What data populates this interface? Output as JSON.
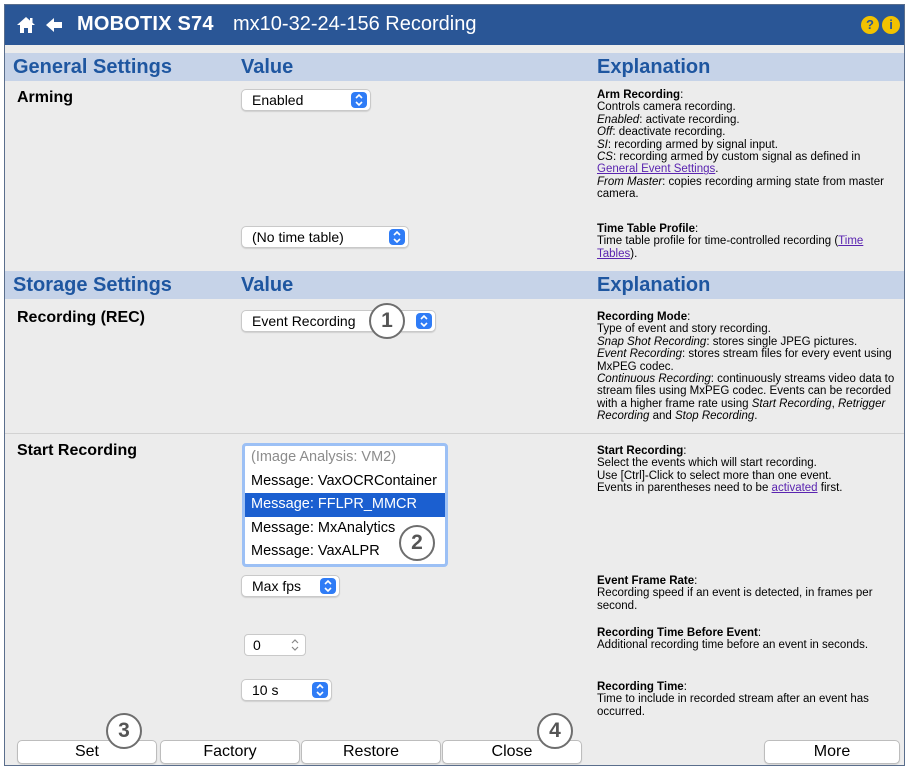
{
  "header": {
    "brand": "MOBOTIX S74",
    "title": "mx10-32-24-156 Recording",
    "help_glyph": "?",
    "info_glyph": "i"
  },
  "general": {
    "col1": "General Settings",
    "col2": "Value",
    "col3": "Explanation",
    "arming_label": "Arming",
    "arming_value": "Enabled",
    "timetable_value": "(No time table)",
    "arm_expl": {
      "head": "Arm Recording",
      "colon": ":",
      "l1": "Controls camera recording.",
      "l2_term": "Enabled",
      "l2_rest": ": activate recording.",
      "l3_term": "Off",
      "l3_rest": ": deactivate recording.",
      "l4_term": "SI",
      "l4_rest": ": recording armed by signal input.",
      "l5_term": "CS",
      "l5_rest": ": recording armed by custom signal as defined in",
      "l6_link": "General Event Settings",
      "l6_rest": ".",
      "l7_term": "From Master",
      "l7_rest": ": copies recording arming state from master camera."
    },
    "tt_expl": {
      "head": "Time Table Profile",
      "colon": ":",
      "text": "Time table profile for time-controlled recording (",
      "link": "Time Tables",
      "end": ")."
    }
  },
  "storage": {
    "col1": "Storage Settings",
    "col2": "Value",
    "col3": "Explanation",
    "rec_label": "Recording (REC)",
    "rec_value": "Event Recording",
    "rec_expl": {
      "head": "Recording Mode",
      "colon": ":",
      "l1": "Type of event and story recording.",
      "l2_term": "Snap Shot Recording",
      "l2_rest": ": stores single JPEG pictures.",
      "l3_term": "Event Recording",
      "l3_rest": ": stores stream files for every event using MxPEG codec.",
      "l4_term": "Continuous Recording",
      "l4_rest": ": continuously streams video data to stream files using MxPEG codec. Events can be recorded with a higher frame rate using ",
      "l4_t1": "Start Recording",
      "l4_c1": ", ",
      "l4_t2": "Retrigger Recording",
      "l4_c2": " and ",
      "l4_t3": "Stop Recording",
      "l4_end": "."
    },
    "start_label": "Start Recording",
    "events": [
      "(Image Analysis: VM2)",
      "Message: VaxOCRContainer",
      "Message: FFLPR_MMCR",
      "Message: MxAnalytics",
      "Message: VaxALPR"
    ],
    "start_expl": {
      "head": "Start Recording",
      "colon": ":",
      "l1": "Select the events which will start recording.",
      "l2": "Use [Ctrl]-Click to select more than one event.",
      "l3": "Events in parentheses need to be ",
      "l3_link": "activated",
      "l3_end": " first."
    },
    "framerate_value": "Max fps",
    "framerate_expl": {
      "head": "Event Frame Rate",
      "colon": ":",
      "text": "Recording speed if an event is detected, in frames per second."
    },
    "before_value": "0",
    "before_expl": {
      "head": "Recording Time Before Event",
      "colon": ":",
      "text": "Additional recording time before an event in seconds."
    },
    "rectime_value": "10 s",
    "rectime_expl": {
      "head": "Recording Time",
      "colon": ":",
      "text": "Time to include in recorded stream after an event has occurred."
    }
  },
  "markers": [
    "1",
    "2",
    "3",
    "4"
  ],
  "buttons": {
    "set": "Set",
    "factory": "Factory",
    "restore": "Restore",
    "close": "Close",
    "more": "More"
  },
  "colors": {
    "titlebar": "#2a5696",
    "section_bar": "#c6d3e8",
    "section_text": "#1e56a0",
    "selected_row": "#1b5fd0"
  }
}
